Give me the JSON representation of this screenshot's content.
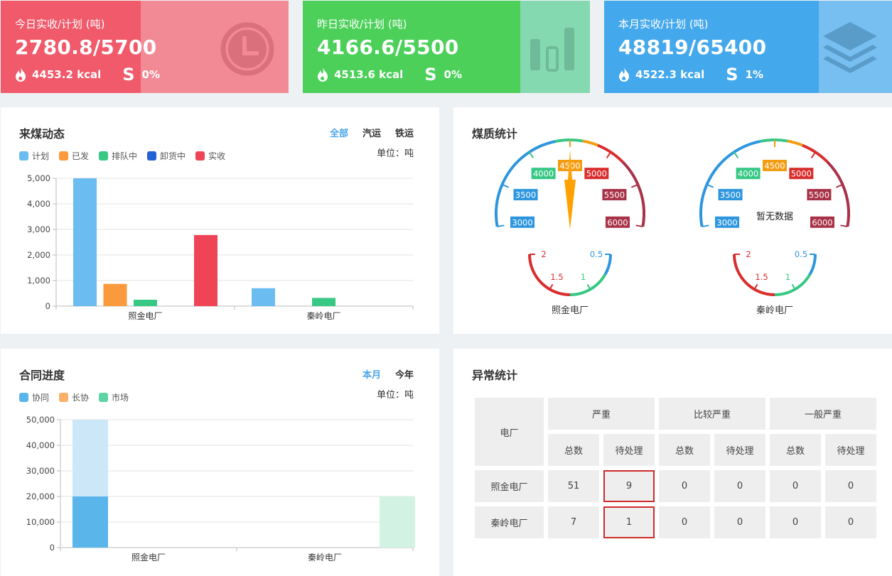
{
  "stats": [
    {
      "caption": "今日实收/计划 (吨)",
      "value": "2780.8/5700",
      "kcal": "4453.2 kcal",
      "s_label": "S",
      "pct": "0%",
      "color": "#f05a6a",
      "overlay": "#f18a95",
      "icon": "clock-icon"
    },
    {
      "caption": "昨日实收/计划 (吨)",
      "value": "4166.6/5500",
      "kcal": "4513.6 kcal",
      "s_label": "S",
      "pct": "0%",
      "color": "#4cd05a",
      "overlay": "#84d9b0",
      "icon": "bar-chart-icon"
    },
    {
      "caption": "本月实收/计划 (吨)",
      "value": "48819/65400",
      "kcal": "4522.3 kcal",
      "s_label": "S",
      "pct": "1%",
      "color": "#44a8ec",
      "overlay": "#77bff0",
      "icon": "layers-icon"
    }
  ],
  "coal_dynamic": {
    "title": "来煤动态",
    "tabs": [
      "全部",
      "汽运",
      "铁运"
    ],
    "active_tab": "全部",
    "unit": "单位：吨",
    "legend": [
      {
        "label": "计划",
        "color": "#6bbcf0"
      },
      {
        "label": "已发",
        "color": "#fb9a3c"
      },
      {
        "label": "排队中",
        "color": "#36c884"
      },
      {
        "label": "卸货中",
        "color": "#2361d6"
      },
      {
        "label": "实收",
        "color": "#ef4455"
      }
    ]
  },
  "coal_quality": {
    "title": "煤质统计",
    "gauges": [
      {
        "name": "照金电厂",
        "top_ticks": [
          "3000",
          "3500",
          "4000",
          "4500",
          "5000",
          "5500",
          "6000"
        ],
        "bottom_ticks": [
          "2",
          "1.5",
          "1",
          "0.5"
        ],
        "value": 4500,
        "no_data": ""
      },
      {
        "name": "秦岭电厂",
        "top_ticks": [
          "3000",
          "3500",
          "4000",
          "4500",
          "5000",
          "5500",
          "6000"
        ],
        "bottom_ticks": [
          "2",
          "1.5",
          "1",
          "0.5"
        ],
        "value": null,
        "no_data": "暂无数据"
      }
    ]
  },
  "contract": {
    "title": "合同进度",
    "tabs": [
      "本月",
      "今年"
    ],
    "active_tab": "本月",
    "unit": "单位：吨",
    "legend": [
      {
        "label": "协同",
        "color": "#5ab5ea"
      },
      {
        "label": "长协",
        "color": "#fbb06a"
      },
      {
        "label": "市场",
        "color": "#5ed3a4"
      }
    ]
  },
  "abnormal": {
    "title": "异常统计",
    "col_plant": "电厂",
    "groups": [
      "严重",
      "比较严重",
      "一般严重"
    ],
    "sub": [
      "总数",
      "待处理"
    ],
    "rows": [
      {
        "plant": "照金电厂",
        "values": [
          "51",
          "9",
          "0",
          "0",
          "0",
          "0"
        ]
      },
      {
        "plant": "秦岭电厂",
        "values": [
          "7",
          "1",
          "0",
          "0",
          "0",
          "0"
        ]
      }
    ]
  },
  "chart_data": [
    {
      "type": "bar",
      "categories": [
        "照金电厂",
        "秦岭电厂"
      ],
      "series": [
        {
          "name": "计划",
          "values": [
            5000,
            700
          ]
        },
        {
          "name": "已发",
          "values": [
            870,
            0
          ]
        },
        {
          "name": "排队中",
          "values": [
            250,
            320
          ]
        },
        {
          "name": "卸货中",
          "values": [
            0,
            0
          ]
        },
        {
          "name": "实收",
          "values": [
            2780.8,
            0
          ]
        }
      ],
      "yticks": [
        "0",
        "1,000",
        "2,000",
        "3,000",
        "4,000",
        "5,000"
      ],
      "ylim": [
        0,
        5000
      ],
      "grid": true
    },
    {
      "type": "bar",
      "categories": [
        "照金电厂",
        "秦岭电厂"
      ],
      "series": [
        {
          "name": "协同",
          "values": [
            20000,
            0
          ],
          "plan": [
            50000,
            0
          ]
        },
        {
          "name": "长协",
          "values": [
            0,
            0
          ],
          "plan": [
            0,
            0
          ]
        },
        {
          "name": "市场",
          "values": [
            0,
            0
          ],
          "plan": [
            0,
            20000
          ]
        }
      ],
      "yticks": [
        "0",
        "10,000",
        "20,000",
        "30,000",
        "40,000",
        "50,000"
      ],
      "ylim": [
        0,
        50000
      ],
      "grid": true
    }
  ]
}
